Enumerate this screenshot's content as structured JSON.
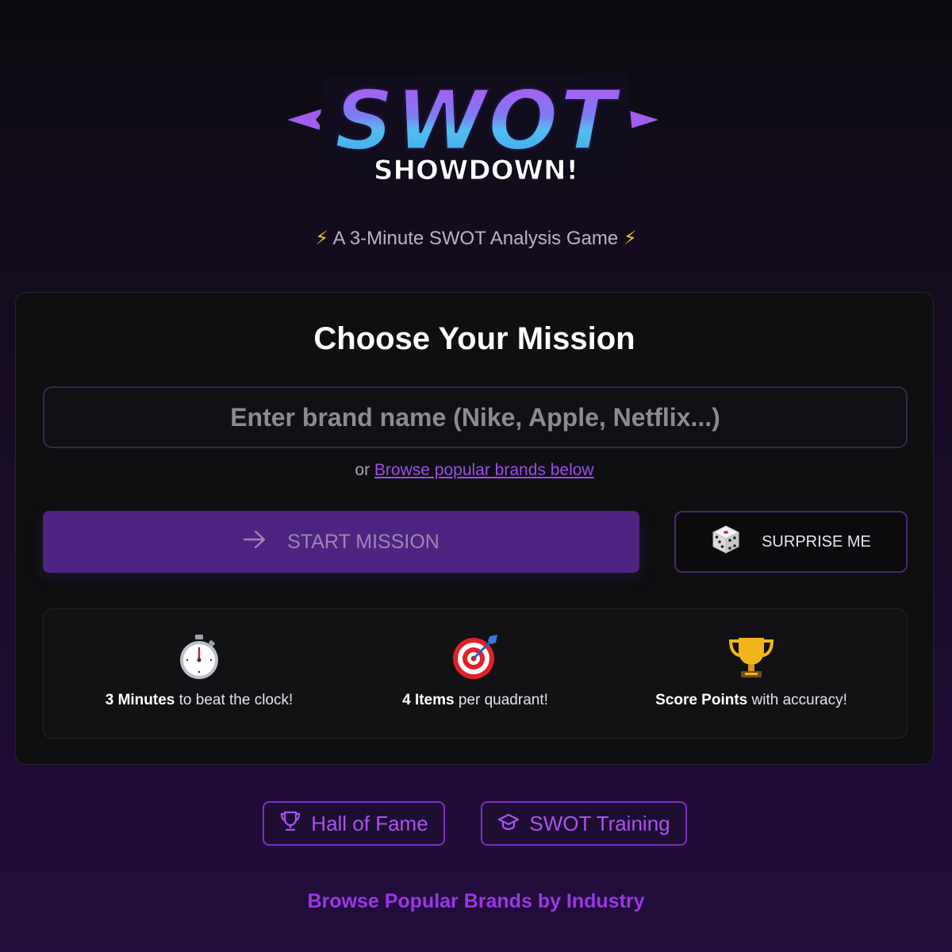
{
  "logo": {
    "title": "SWOT",
    "subtitle": "SHOWDOWN!"
  },
  "tagline": {
    "icon_left": "lightning-icon",
    "text": "A 3-Minute SWOT Analysis Game",
    "icon_right": "lightning-icon"
  },
  "mission": {
    "title": "Choose Your Mission",
    "input": {
      "placeholder": "Enter brand name (Nike, Apple, Netflix...)",
      "value": ""
    },
    "browse_prefix": "or",
    "browse_link": "Browse popular brands below",
    "start_button": {
      "icon": "arrow-right-icon",
      "label": "START MISSION",
      "state": "disabled"
    },
    "surprise_button": {
      "icon": "dice-icon",
      "label": "SURPRISE ME"
    },
    "features": [
      {
        "icon": "stopwatch-icon",
        "bold": "3 Minutes",
        "text": "to beat the clock!"
      },
      {
        "icon": "target-icon",
        "bold": "4 Items",
        "text": "per quadrant!"
      },
      {
        "icon": "trophy-icon",
        "bold": "Score Points",
        "text": "with accuracy!"
      }
    ]
  },
  "links": {
    "hall_of_fame": {
      "icon": "trophy-outline-icon",
      "label": "Hall of Fame"
    },
    "swot_training": {
      "icon": "graduation-cap-icon",
      "label": "SWOT Training"
    }
  },
  "browse_heading": "Browse Popular Brands by Industry",
  "colors": {
    "accent": "#9b37e6",
    "start_button": "#4f2381",
    "card_background": "#0f0f11"
  }
}
